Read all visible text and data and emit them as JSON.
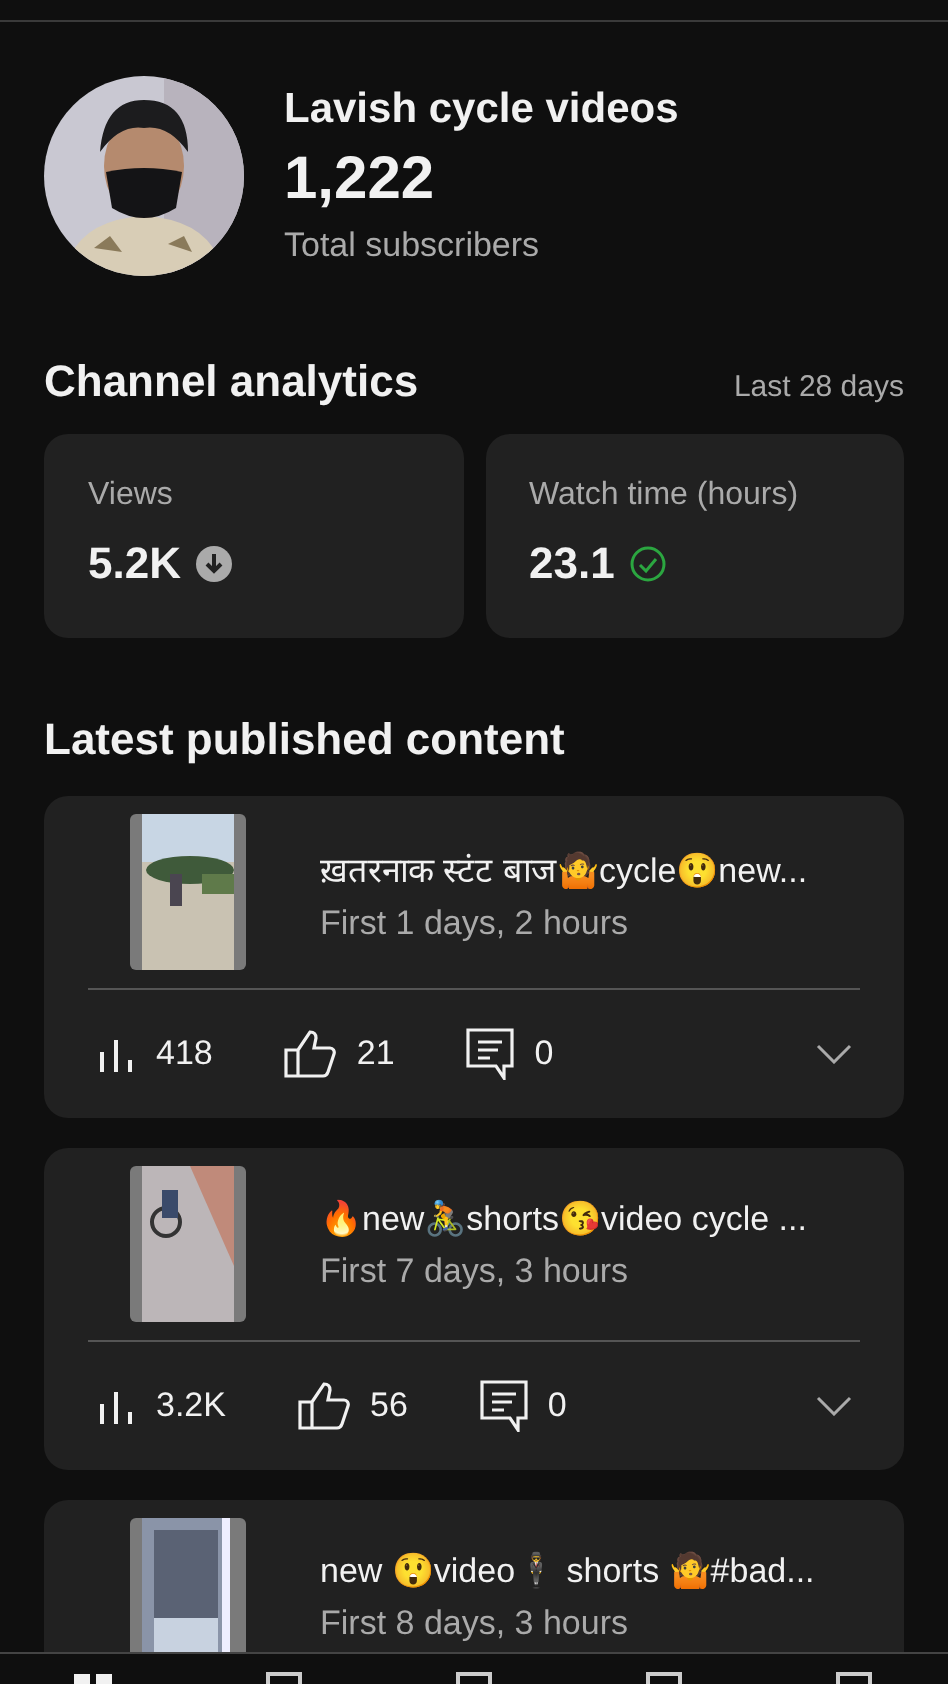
{
  "channel": {
    "name": "Lavish cycle videos",
    "subscribers": "1,222",
    "subscribers_label": "Total subscribers"
  },
  "analytics": {
    "title": "Channel analytics",
    "period": "Last 28 days",
    "cards": [
      {
        "label": "Views",
        "value": "5.2K",
        "kind": "down"
      },
      {
        "label": "Watch time (hours)",
        "value": "23.1",
        "kind": "check"
      }
    ]
  },
  "latest": {
    "title": "Latest published content",
    "items": [
      {
        "title": "ख़तरनाक स्टंट बाज🤷cycle😲new...",
        "subtitle": "First 1 days, 2 hours",
        "views": "418",
        "likes": "21",
        "comments": "0"
      },
      {
        "title": "🔥new🚴shorts😘video cycle ...",
        "subtitle": "First 7 days, 3 hours",
        "views": "3.2K",
        "likes": "56",
        "comments": "0"
      },
      {
        "title": "new 😲video🕴 shorts 🤷#bad...",
        "subtitle": "First 8 days, 3 hours"
      }
    ]
  }
}
